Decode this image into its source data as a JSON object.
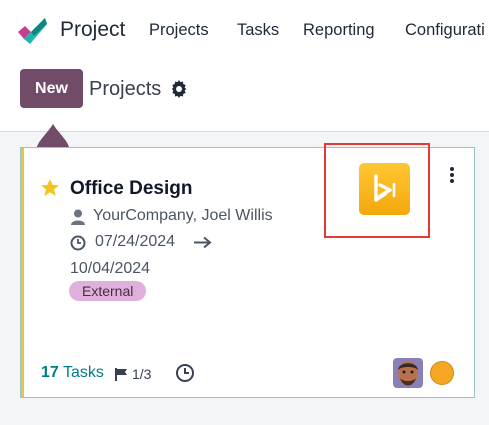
{
  "navbar": {
    "app_name": "Project",
    "menu": [
      "Projects",
      "Tasks",
      "Reporting",
      "Configurati"
    ]
  },
  "control_panel": {
    "new_label": "New",
    "breadcrumb": "Projects"
  },
  "card": {
    "title": "Office Design",
    "customer": "YourCompany, Joel Willis",
    "date_start": "07/24/2024",
    "date_end": "10/04/2024",
    "tag": "External",
    "tasks_count": "17",
    "tasks_label": "Tasks",
    "milestones": "1/3",
    "favorite": true
  },
  "colors": {
    "primary": "#714b67",
    "accent_teal": "#017e84",
    "stripe": "#e4c640",
    "tag_bg": "#e0b0dc",
    "highlight": "#e53935",
    "app_tile": "#f4a80c"
  },
  "icons": [
    "project-logo-icon",
    "gear-icon",
    "star-icon",
    "kebab-menu-icon",
    "user-icon",
    "clock-icon",
    "arrow-right-icon",
    "flag-icon",
    "activity-clock-icon",
    "app-tile-icon"
  ]
}
